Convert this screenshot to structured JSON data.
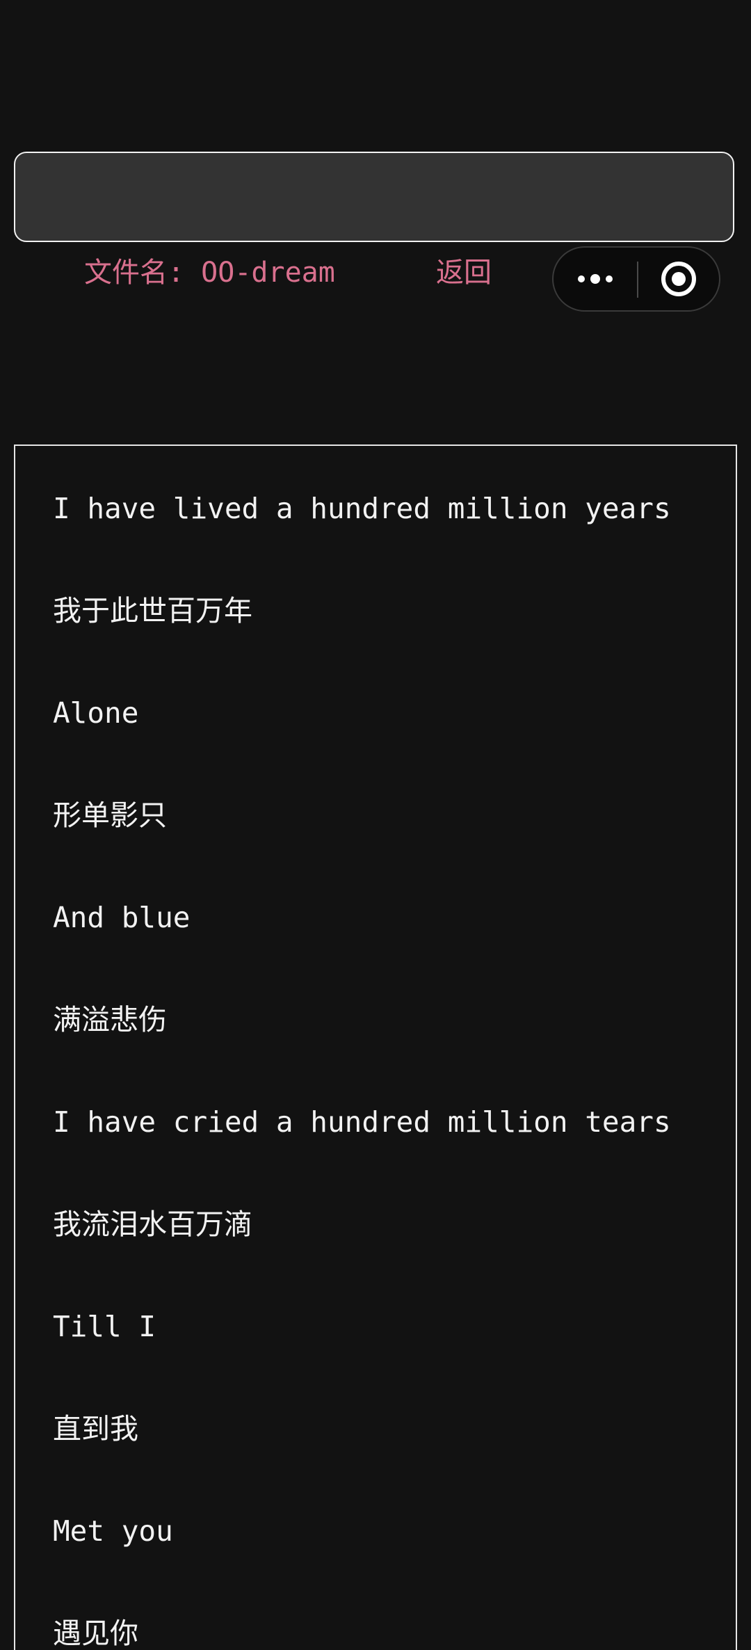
{
  "header": {
    "file_label": "文件名: OO-dream",
    "back_label": "返回"
  },
  "capsule": {
    "more_icon": "more-dots-icon",
    "close_icon": "target-close-icon"
  },
  "lyrics": [
    "I have lived a hundred million years",
    "我于此世百万年",
    "Alone",
    "形单影只",
    "And blue",
    "满溢悲伤",
    "I have cried a hundred million tears",
    "我流泪水百万滴",
    "Till I",
    "直到我",
    "Met you",
    "遇见你"
  ]
}
